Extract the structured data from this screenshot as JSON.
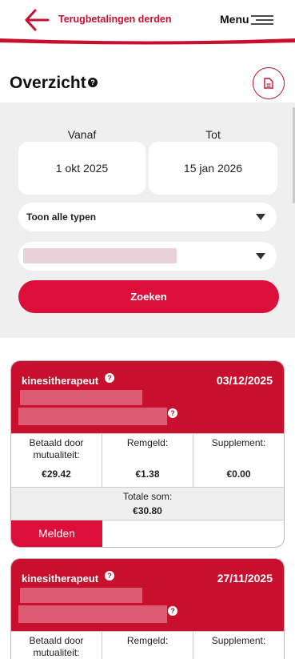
{
  "header": {
    "title": "Terugbetalingen derden",
    "menu_label": "Menu",
    "back_icon": "arrow-left-icon",
    "menu_icon": "hamburger-icon",
    "accent_color": "#c8102e"
  },
  "overview": {
    "title": "Overzicht",
    "help_icon": "question-icon",
    "document_icon": "document-icon"
  },
  "filter": {
    "from_label": "Vanaf",
    "from_value": "1 okt 2025",
    "to_label": "Tot",
    "to_value": "15 jan 2026",
    "type_select": "Toon alle typen",
    "search_button": "Zoeken"
  },
  "cards": [
    {
      "type": "kinesitherapeut",
      "date": "03/12/2025",
      "paid_label": "Betaald door mutualiteit:",
      "paid_value": "€29.42",
      "remgeld_label": "Remgeld:",
      "remgeld_value": "€1.38",
      "supplement_label": "Supplement:",
      "supplement_value": "€0.00",
      "total_label": "Totale som:",
      "total_value": "€30.80",
      "action": "Melden"
    },
    {
      "type": "kinesitherapeut",
      "date": "27/11/2025",
      "paid_label": "Betaald door mutualiteit:",
      "remgeld_label": "Remgeld:",
      "supplement_label": "Supplement:"
    }
  ]
}
